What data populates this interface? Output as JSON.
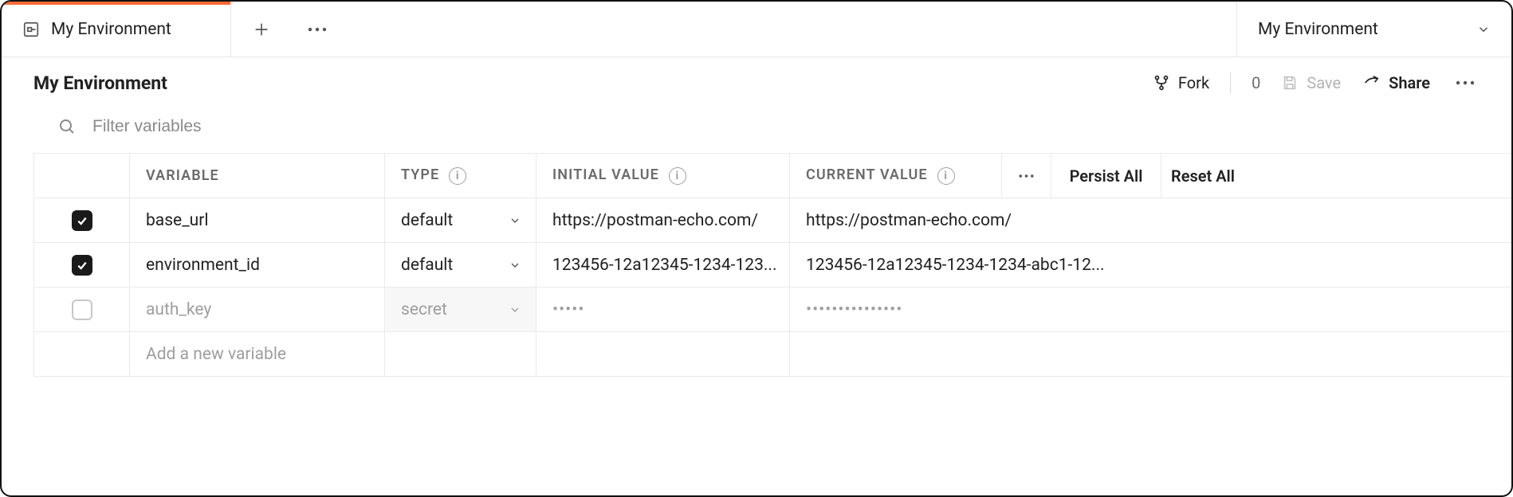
{
  "tab": {
    "label": "My Environment"
  },
  "envSelector": {
    "label": "My Environment"
  },
  "toolbar": {
    "title": "My Environment",
    "fork_label": "Fork",
    "fork_count": "0",
    "save_label": "Save",
    "share_label": "Share"
  },
  "filter": {
    "placeholder": "Filter variables"
  },
  "table": {
    "headers": {
      "variable": "VARIABLE",
      "type": "TYPE",
      "initial": "INITIAL VALUE",
      "current": "CURRENT VALUE",
      "persist": "Persist All",
      "reset": "Reset All"
    },
    "rows": [
      {
        "checked": true,
        "variable": "base_url",
        "type": "default",
        "type_muted": false,
        "initial": "https://postman-echo.com/",
        "current": "https://postman-echo.com/",
        "secret": false
      },
      {
        "checked": true,
        "variable": "environment_id",
        "type": "default",
        "type_muted": false,
        "initial": "123456-12a12345-1234-123...",
        "current": "123456-12a12345-1234-1234-abc1-12...",
        "secret": false
      },
      {
        "checked": false,
        "variable": "auth_key",
        "type": "secret",
        "type_muted": true,
        "initial": "•••••",
        "current": "•••••••••••••••",
        "secret": true
      }
    ],
    "new_row_placeholder": "Add a new variable"
  }
}
